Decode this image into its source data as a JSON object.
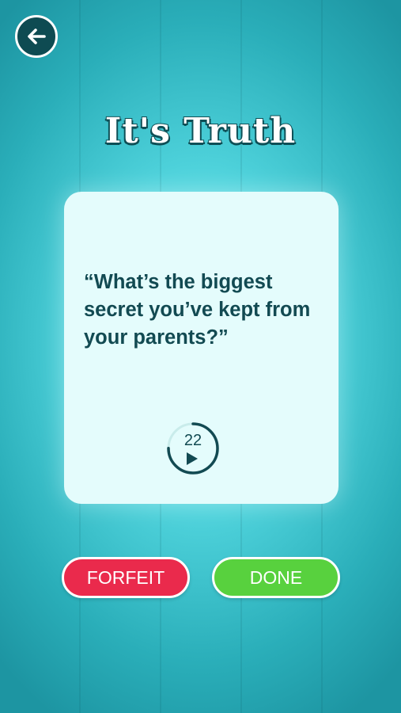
{
  "screen": {
    "title": "It's Truth"
  },
  "header": {
    "back_icon": "arrow-left-icon"
  },
  "card": {
    "question": "“What’s the biggest secret you’ve kept from your parents?”",
    "timer": {
      "count": "22",
      "icon": "play-icon",
      "progress": 0.75
    }
  },
  "actions": {
    "forfeit_label": "FORFEIT",
    "done_label": "DONE"
  },
  "colors": {
    "background": "#4fd3dc",
    "card": "#e4fcfc",
    "text_dark": "#124a52",
    "forfeit": "#ea2a4c",
    "done": "#58d13e"
  }
}
